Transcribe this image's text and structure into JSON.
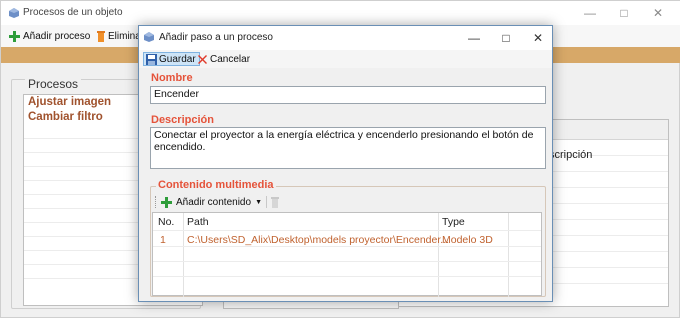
{
  "background_window": {
    "title": "Procesos de un objeto",
    "controls": {
      "minimize": "—",
      "maximize": "□",
      "close": "✕"
    },
    "toolbar": {
      "add_process": "Añadir proceso",
      "delete": "Eliminar"
    },
    "group_title": "Procesos",
    "processes": [
      "Ajustar imagen",
      "Cambiar filtro"
    ],
    "right_column_fragment": "scripción"
  },
  "dialog": {
    "title": "Añadir paso a un proceso",
    "controls": {
      "minimize": "—",
      "maximize": "□",
      "close": "✕"
    },
    "toolbar": {
      "save_label": "Guardar",
      "cancel_label": "Cancelar"
    },
    "name": {
      "label": "Nombre",
      "value": "Encender"
    },
    "description": {
      "label": "Descripción",
      "value": "Conectar el proyector  a la energía eléctrica y encenderlo presionando el botón de encendido."
    },
    "multimedia": {
      "title": "Contenido multimedia",
      "add_content_label": "Añadir contenido",
      "columns": {
        "no": "No.",
        "path": "Path",
        "type": "Type"
      },
      "rows": [
        {
          "no": "1",
          "path": "C:\\Users\\SD_Alix\\Desktop\\models proyector\\Encender...",
          "type": "Modelo 3D"
        }
      ]
    }
  },
  "colors": {
    "accent_label": "#e5533a",
    "band": "#d7a868",
    "cell_text": "#c0622f",
    "list_text": "#a0522d"
  }
}
